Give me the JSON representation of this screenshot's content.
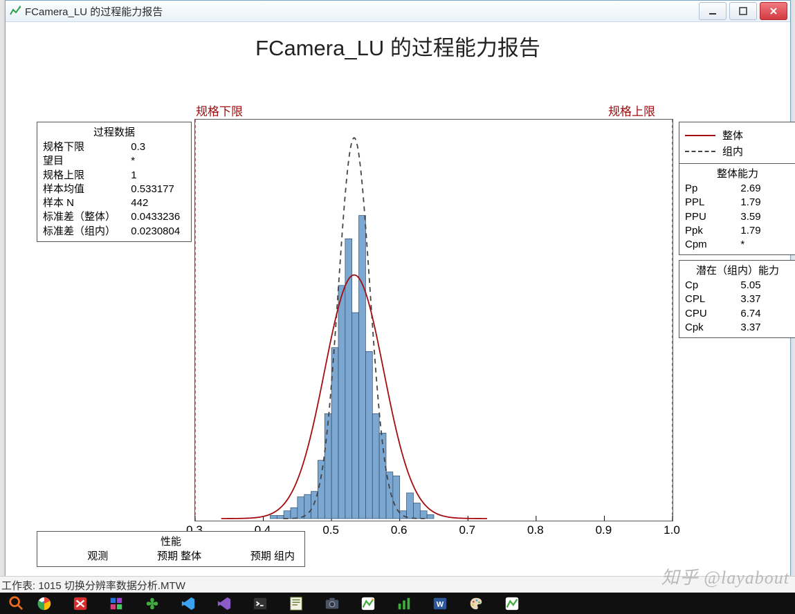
{
  "window": {
    "title": "FCamera_LU 的过程能力报告"
  },
  "report_title": "FCamera_LU 的过程能力报告",
  "spec_labels": {
    "lower": "规格下限",
    "upper": "规格上限"
  },
  "process_data": {
    "header": "过程数据",
    "rows": [
      {
        "label": "规格下限",
        "value": "0.3"
      },
      {
        "label": "望目",
        "value": "*"
      },
      {
        "label": "规格上限",
        "value": "1"
      },
      {
        "label": "样本均值",
        "value": "0.533177"
      },
      {
        "label": "样本 N",
        "value": "442"
      },
      {
        "label": "标准差（整体）",
        "value": "0.0433236"
      },
      {
        "label": "标准差（组内）",
        "value": "0.0230804"
      }
    ]
  },
  "legend": {
    "overall": "整体",
    "within": "组内"
  },
  "overall_capability": {
    "header": "整体能力",
    "rows": [
      {
        "label": "Pp",
        "value": "2.69"
      },
      {
        "label": "PPL",
        "value": "1.79"
      },
      {
        "label": "PPU",
        "value": "3.59"
      },
      {
        "label": "Ppk",
        "value": "1.79"
      },
      {
        "label": "Cpm",
        "value": "*"
      }
    ]
  },
  "within_capability": {
    "header": "潜在（组内）能力",
    "rows": [
      {
        "label": "Cp",
        "value": "5.05"
      },
      {
        "label": "CPL",
        "value": "3.37"
      },
      {
        "label": "CPU",
        "value": "6.74"
      },
      {
        "label": "Cpk",
        "value": "3.37"
      }
    ]
  },
  "performance": {
    "header": "性能",
    "cols": [
      "观测",
      "预期 整体",
      "预期 组内"
    ]
  },
  "worksheet": "工作表: 1015 切换分辨率数据分析.MTW",
  "watermark": "知乎 @layabout",
  "chart_data": {
    "type": "histogram+curves",
    "title": "FCamera_LU 的过程能力报告",
    "xlabel": "",
    "ylabel": "",
    "xlim": [
      0.3,
      1.0
    ],
    "xticks": [
      0.3,
      0.4,
      0.5,
      0.6,
      0.7,
      0.8,
      0.9,
      1.0
    ],
    "spec_limits": {
      "lsl": 0.3,
      "usl": 1.0
    },
    "sample_mean": 0.533177,
    "sample_n": 442,
    "std_overall": 0.0433236,
    "std_within": 0.0230804,
    "bar_width": 0.01,
    "bars": [
      {
        "x": 0.415,
        "h": 0.008
      },
      {
        "x": 0.425,
        "h": 0.008
      },
      {
        "x": 0.435,
        "h": 0.02
      },
      {
        "x": 0.445,
        "h": 0.028
      },
      {
        "x": 0.455,
        "h": 0.056
      },
      {
        "x": 0.465,
        "h": 0.062
      },
      {
        "x": 0.475,
        "h": 0.07
      },
      {
        "x": 0.485,
        "h": 0.15
      },
      {
        "x": 0.495,
        "h": 0.27
      },
      {
        "x": 0.505,
        "h": 0.44
      },
      {
        "x": 0.515,
        "h": 0.6
      },
      {
        "x": 0.525,
        "h": 0.72
      },
      {
        "x": 0.535,
        "h": 0.53
      },
      {
        "x": 0.545,
        "h": 0.78
      },
      {
        "x": 0.555,
        "h": 0.43
      },
      {
        "x": 0.565,
        "h": 0.27
      },
      {
        "x": 0.575,
        "h": 0.22
      },
      {
        "x": 0.585,
        "h": 0.12
      },
      {
        "x": 0.595,
        "h": 0.11
      },
      {
        "x": 0.605,
        "h": 0.02
      },
      {
        "x": 0.615,
        "h": 0.066
      },
      {
        "x": 0.625,
        "h": 0.04
      },
      {
        "x": 0.635,
        "h": 0.02
      },
      {
        "x": 0.645,
        "h": 0.01
      }
    ],
    "curves": {
      "overall": {
        "mean": 0.533177,
        "sd": 0.0433236,
        "peak_rel": 0.64
      },
      "within": {
        "mean": 0.533177,
        "sd": 0.0230804,
        "peak_rel": 1.0
      }
    },
    "max_density_rel": 1.0,
    "legend": {
      "overall": "整体",
      "within": "组内"
    }
  }
}
